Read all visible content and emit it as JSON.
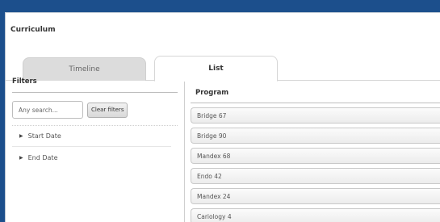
{
  "panel": {
    "title": "Curriculum"
  },
  "tabs": [
    {
      "label": "Timeline",
      "active": false
    },
    {
      "label": "List",
      "active": true
    }
  ],
  "filters": {
    "title": "Filters",
    "search_placeholder": "Any search...",
    "clear_label": "Clear filters",
    "items": [
      {
        "label": "Start Date"
      },
      {
        "label": "End Date"
      }
    ]
  },
  "program": {
    "title": "Program",
    "rows": [
      "Bridge 67",
      "Bridge 90",
      "Mandex 68",
      "Endo 42",
      "Mandex 24",
      "Cariology 4"
    ]
  },
  "colors": {
    "background": "#1c4f8c",
    "panel": "#ffffff",
    "tab_inactive": "#dcdcdc"
  }
}
